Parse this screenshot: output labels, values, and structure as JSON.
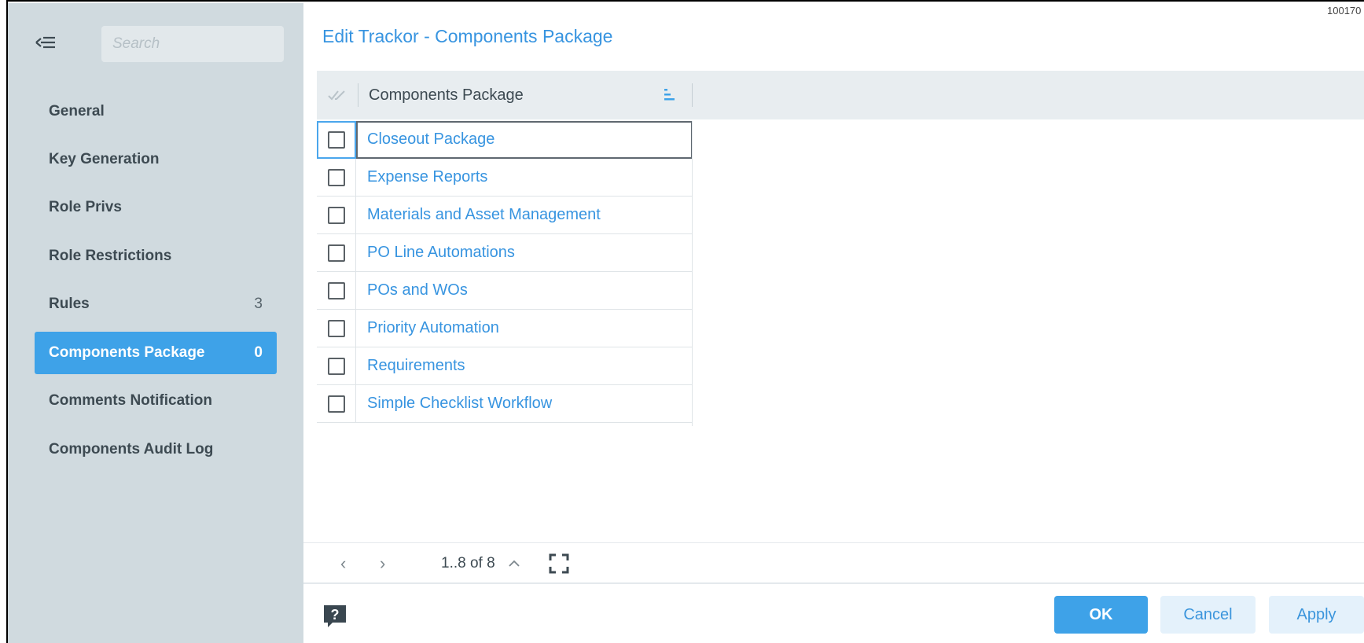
{
  "window": {
    "corner_id": "100170"
  },
  "sidebar": {
    "search": {
      "placeholder": "Search",
      "value": ""
    },
    "items": [
      {
        "label": "General",
        "count": ""
      },
      {
        "label": "Key Generation",
        "count": ""
      },
      {
        "label": "Role Privs",
        "count": ""
      },
      {
        "label": "Role Restrictions",
        "count": ""
      },
      {
        "label": "Rules",
        "count": "3"
      },
      {
        "label": "Components Package",
        "count": "0",
        "active": true
      },
      {
        "label": "Comments Notification",
        "count": ""
      },
      {
        "label": "Components Audit Log",
        "count": ""
      }
    ]
  },
  "main": {
    "title": "Edit Trackor - Components Package",
    "grid": {
      "column_header": "Components Package",
      "rows": [
        {
          "label": "Closeout Package",
          "checked": false
        },
        {
          "label": "Expense Reports",
          "checked": false
        },
        {
          "label": "Materials and Asset Management",
          "checked": false
        },
        {
          "label": "PO Line Automations",
          "checked": false
        },
        {
          "label": "POs and WOs",
          "checked": false
        },
        {
          "label": "Priority Automation",
          "checked": false
        },
        {
          "label": "Requirements",
          "checked": false
        },
        {
          "label": "Simple Checklist Workflow",
          "checked": false
        }
      ]
    },
    "pager": {
      "prev": "‹",
      "next": "›",
      "range": "1..8 of 8"
    }
  },
  "footer": {
    "ok_label": "OK",
    "cancel_label": "Cancel",
    "apply_label": "Apply"
  },
  "colors": {
    "accent": "#3ea2e8",
    "link": "#3794e0",
    "sidebar_bg": "#d0dadf"
  }
}
